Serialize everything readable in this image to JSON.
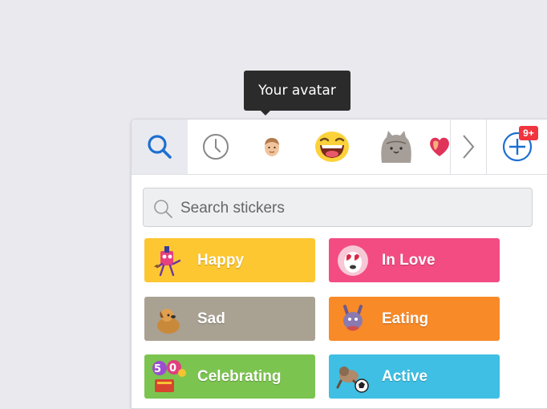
{
  "tooltip": {
    "text": "Your avatar"
  },
  "tabs": [
    {
      "name": "search-tab",
      "icon": "search-icon"
    },
    {
      "name": "recent-tab",
      "icon": "clock-icon"
    },
    {
      "name": "avatar-tab",
      "icon": "avatar-face-icon"
    },
    {
      "name": "laughing-tab",
      "icon": "laughing-emoji-icon"
    },
    {
      "name": "cat-tab",
      "icon": "grey-cat-icon"
    },
    {
      "name": "heart-tab",
      "icon": "heart-sticker-icon"
    },
    {
      "name": "next-tab",
      "icon": "chevron-right-icon"
    },
    {
      "name": "store-tab",
      "icon": "plus-circle-icon"
    }
  ],
  "store_badge": "9+",
  "search": {
    "placeholder": "Search stickers"
  },
  "categories": [
    {
      "label": "Happy",
      "color": "#fdc731"
    },
    {
      "label": "In Love",
      "color": "#f24c83"
    },
    {
      "label": "Sad",
      "color": "#a9a192"
    },
    {
      "label": "Eating",
      "color": "#f88a28"
    },
    {
      "label": "Celebrating",
      "color": "#7cc450"
    },
    {
      "label": "Active",
      "color": "#3ebfe3"
    }
  ],
  "colors": {
    "accent": "#1d6fd0",
    "tooltip_bg": "#2b2b2b",
    "badge": "#f0353f"
  }
}
